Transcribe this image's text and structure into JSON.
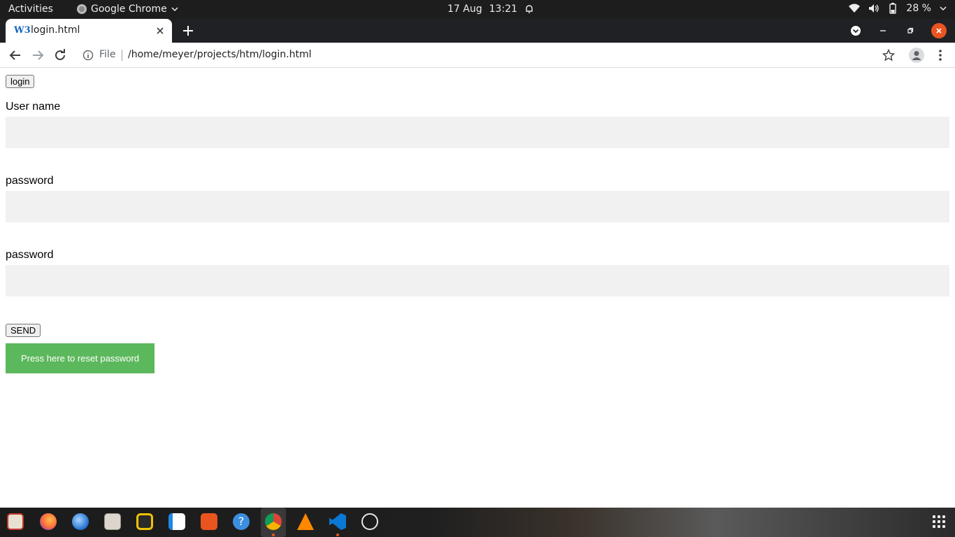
{
  "topbar": {
    "activities": "Activities",
    "app_name": "Google Chrome",
    "date": "17 Aug",
    "time": "13:21",
    "battery": "28 %"
  },
  "browser": {
    "tab_title": "login.html",
    "url_scheme": "File",
    "url": "/home/meyer/projects/htm/login.html",
    "favicon_text": "W3"
  },
  "page": {
    "login_button": "login",
    "username_label": "User name",
    "username_value": "",
    "password_label": "password",
    "password_value": "",
    "password_confirm_label": "password",
    "password_confirm_value": "",
    "send_button": "SEND",
    "reset_button": "Press here to reset password",
    "reset_button_color": "#5cb85c",
    "input_background": "#f1f1f1"
  },
  "dock": {
    "apps": [
      "mail-app-icon",
      "firefox-icon",
      "thunderbird-icon",
      "files-icon",
      "rhythmbox-icon",
      "writer-icon",
      "software-icon",
      "help-icon",
      "chrome-icon",
      "vlc-icon",
      "vscode-icon",
      "obs-icon"
    ]
  }
}
